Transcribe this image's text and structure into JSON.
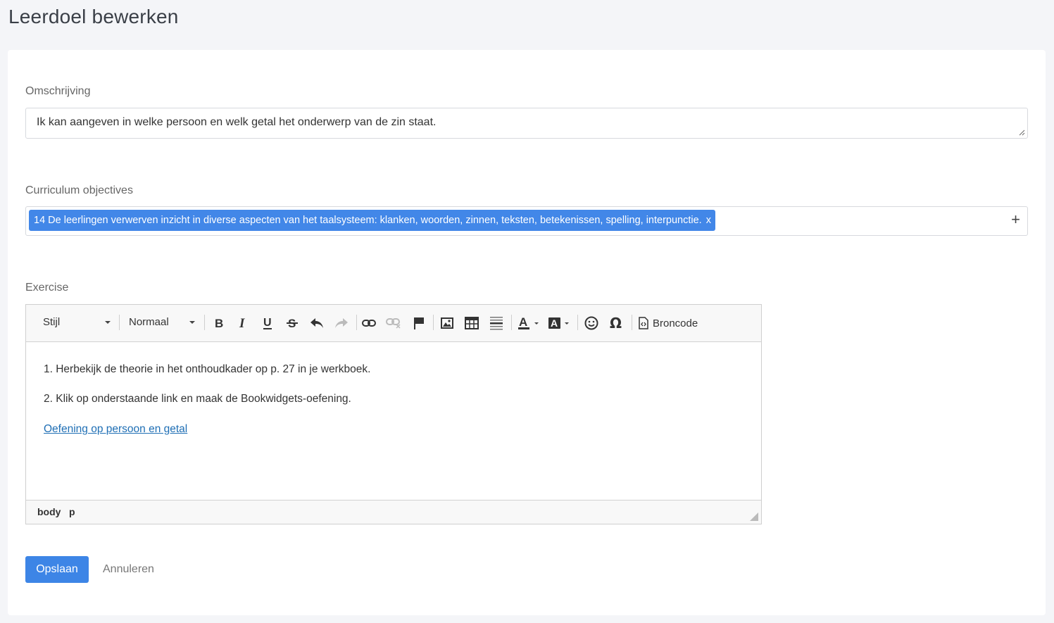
{
  "page": {
    "title": "Leerdoel bewerken"
  },
  "description": {
    "label": "Omschrijving",
    "value": "Ik kan aangeven in welke persoon en welk getal het onderwerp van de zin staat."
  },
  "curriculum": {
    "label": "Curriculum objectives",
    "tags": [
      {
        "text": "14 De leerlingen verwerven inzicht in diverse aspecten van het taalsysteem: klanken, woorden, zinnen, teksten, betekenissen, spelling, interpunctie.",
        "remove": "x"
      }
    ],
    "add_symbol": "+"
  },
  "exercise": {
    "label": "Exercise",
    "toolbar": {
      "style_combo": "Stijl",
      "format_combo": "Normaal",
      "source_label": "Broncode",
      "icons": [
        "bold-icon",
        "italic-icon",
        "underline-icon",
        "strikethrough-icon",
        "undo-icon",
        "redo-icon",
        "link-icon",
        "unlink-icon",
        "anchor-flag-icon",
        "image-icon",
        "table-icon",
        "horizontal-rule-icon",
        "text-color-icon",
        "background-color-icon",
        "smiley-icon",
        "special-char-omega-icon",
        "source-code-icon"
      ]
    },
    "content": {
      "line1": "1. Herbekijk de theorie in het onthoudkader op p. 27 in je werkboek.",
      "line2": "2. Klik op onderstaande link en maak de Bookwidgets-oefening.",
      "link": "Oefening op persoon en getal"
    },
    "path": [
      "body",
      "p"
    ]
  },
  "actions": {
    "save": "Opslaan",
    "cancel": "Annuleren"
  },
  "colors": {
    "primary": "#3d85e6",
    "tag_bg": "#4287e8",
    "link": "#1f6fb5",
    "background": "#f4f5f8"
  }
}
